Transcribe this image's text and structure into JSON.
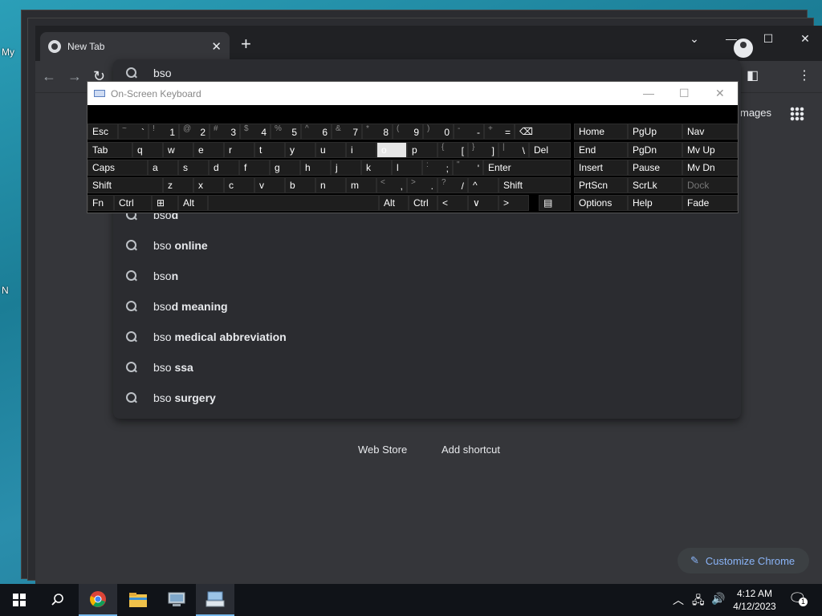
{
  "desktop": {
    "icon_labels": [
      "My",
      "N"
    ]
  },
  "browser": {
    "tab_title": "New Tab",
    "tab_close": "✕",
    "new_tab": "+",
    "window_controls": {
      "dropdown": "⌄",
      "minimize": "—",
      "maximize": "☐",
      "close": "✕"
    },
    "nav": {
      "back": "←",
      "forward": "→",
      "reload": "↻"
    },
    "images_link": "mages",
    "customize_label": "Customize Chrome",
    "shortcuts": [
      "Web Store",
      "Add shortcut"
    ]
  },
  "omnibox": {
    "query": "bso",
    "suggestions": [
      {
        "typed": "bso",
        "rest": "d"
      },
      {
        "typed": "bso",
        "rest": " online"
      },
      {
        "typed": "bso",
        "rest": "n"
      },
      {
        "typed": "bso",
        "rest": "d meaning"
      },
      {
        "typed": "bso",
        "rest": " medical abbreviation"
      },
      {
        "typed": "bso",
        "rest": " ssa"
      },
      {
        "typed": "bso",
        "rest": " surgery"
      }
    ]
  },
  "osk": {
    "title": "On-Screen Keyboard",
    "controls": {
      "minimize": "—",
      "maximize": "☐",
      "close": "✕"
    },
    "row1": [
      {
        "main": "Esc"
      },
      {
        "shift": "~",
        "main": "`"
      },
      {
        "shift": "!",
        "main": "1"
      },
      {
        "shift": "@",
        "main": "2"
      },
      {
        "shift": "#",
        "main": "3"
      },
      {
        "shift": "$",
        "main": "4"
      },
      {
        "shift": "%",
        "main": "5"
      },
      {
        "shift": "^",
        "main": "6"
      },
      {
        "shift": "&",
        "main": "7"
      },
      {
        "shift": "*",
        "main": "8"
      },
      {
        "shift": "(",
        "main": "9"
      },
      {
        "shift": ")",
        "main": "0"
      },
      {
        "shift": "-",
        "main": "-"
      },
      {
        "shift": "+",
        "main": "="
      },
      {
        "main": "⌫"
      }
    ],
    "row2": [
      {
        "main": "Tab"
      },
      {
        "main": "q"
      },
      {
        "main": "w"
      },
      {
        "main": "e"
      },
      {
        "main": "r"
      },
      {
        "main": "t"
      },
      {
        "main": "y"
      },
      {
        "main": "u"
      },
      {
        "main": "i"
      },
      {
        "main": "o"
      },
      {
        "main": "p"
      },
      {
        "shift": "{",
        "main": "["
      },
      {
        "shift": "}",
        "main": "]"
      },
      {
        "shift": "|",
        "main": "\\"
      },
      {
        "main": "Del"
      }
    ],
    "row3": [
      {
        "main": "Caps"
      },
      {
        "main": "a"
      },
      {
        "main": "s"
      },
      {
        "main": "d"
      },
      {
        "main": "f"
      },
      {
        "main": "g"
      },
      {
        "main": "h"
      },
      {
        "main": "j"
      },
      {
        "main": "k"
      },
      {
        "main": "l"
      },
      {
        "shift": ":",
        "main": ";"
      },
      {
        "shift": "\"",
        "main": "'"
      },
      {
        "main": "Enter"
      }
    ],
    "row4": [
      {
        "main": "Shift"
      },
      {
        "main": "z"
      },
      {
        "main": "x"
      },
      {
        "main": "c"
      },
      {
        "main": "v"
      },
      {
        "main": "b"
      },
      {
        "main": "n"
      },
      {
        "main": "m"
      },
      {
        "shift": "<",
        "main": ","
      },
      {
        "shift": ">",
        "main": "."
      },
      {
        "shift": "?",
        "main": "/"
      },
      {
        "main": "^"
      },
      {
        "main": "Shift"
      }
    ],
    "row5": [
      {
        "main": "Fn"
      },
      {
        "main": "Ctrl"
      },
      {
        "main": "⊞"
      },
      {
        "main": "Alt"
      },
      {
        "main": ""
      },
      {
        "main": "Alt"
      },
      {
        "main": "Ctrl"
      },
      {
        "main": "<"
      },
      {
        "main": "∨"
      },
      {
        "main": ">"
      },
      {
        "main": "▤"
      }
    ],
    "nav_grid": [
      [
        "Home",
        "PgUp",
        "Nav"
      ],
      [
        "End",
        "PgDn",
        "Mv Up"
      ],
      [
        "Insert",
        "Pause",
        "Mv Dn"
      ],
      [
        "PrtScn",
        "ScrLk",
        "Dock"
      ],
      [
        "Options",
        "Help",
        "Fade"
      ]
    ]
  },
  "taskbar": {
    "time": "4:12 AM",
    "date": "4/12/2023",
    "notification_count": "1"
  },
  "colors": {
    "accent": "#8ab4f8",
    "chrome_bg": "#35363a",
    "taskbar": "#101318"
  }
}
